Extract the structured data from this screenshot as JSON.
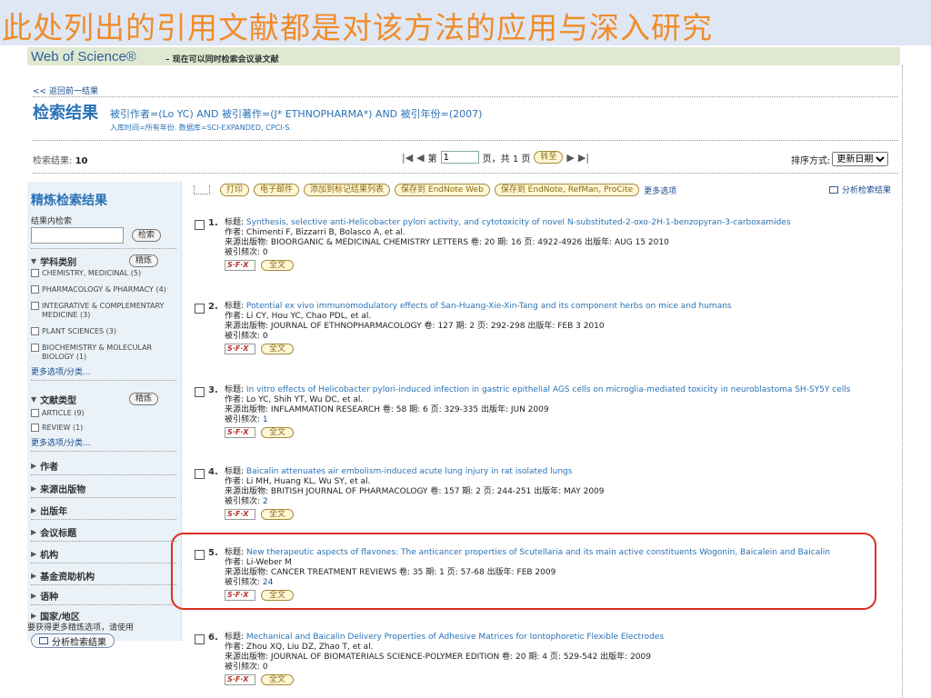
{
  "banner": {
    "text": "此处列出的引用文献都是对该方法的应用与深入研究"
  },
  "header": {
    "logo": "Web of Science®",
    "subtitle": "– 现在可以同时检索会议录文献"
  },
  "back_link": "<< 返回前一结果",
  "result": {
    "title": "检索结果",
    "query": "被引作者=(Lo YC) AND 被引著作=(J* ETHNOPHARMA*) AND 被引年份=(2007)",
    "meta": "入库时间=所有年份. 数据库=SCI-EXPANDED, CPCI-S."
  },
  "count": {
    "label": "检索结果:",
    "value": "10"
  },
  "pager": {
    "prefix": "第",
    "page": "1",
    "suffix": "页，共 1 页",
    "go": "转至",
    "first": "|◀",
    "prev": "◀",
    "next": "▶",
    "last": "▶|"
  },
  "sort": {
    "label": "排序方式:",
    "value": "更新日期"
  },
  "sidebar": {
    "title": "精炼检索结果",
    "within_label": "结果内检索",
    "search_btn": "检索",
    "refine_btn": "精炼",
    "sections": [
      {
        "title": "学科类别",
        "items": [
          "CHEMISTRY, MEDICINAL (5)",
          "PHARMACOLOGY & PHARMACY (4)",
          "INTEGRATIVE & COMPLEMENTARY MEDICINE (3)",
          "PLANT SCIENCES (3)",
          "BIOCHEMISTRY & MOLECULAR BIOLOGY (1)"
        ],
        "more": "更多选项/分类..."
      },
      {
        "title": "文献类型",
        "items": [
          "ARTICLE (9)",
          "REVIEW (1)"
        ],
        "more": "更多选项/分类..."
      }
    ],
    "collapsed": [
      "作者",
      "来源出版物",
      "出版年",
      "会议标题",
      "机构",
      "基金资助机构",
      "语种",
      "国家/地区"
    ],
    "note": "要获得更多精炼选项，请使用",
    "analyze_btn": "分析检索结果"
  },
  "toolbar": {
    "print": "打印",
    "email": "电子邮件",
    "add_marked": "添加到标记结果列表",
    "save_endnote_web": "保存到 EndNote Web",
    "save_endnote_refman": "保存到 EndNote, RefMan, ProCite",
    "more": "更多选项",
    "analyze": "分析检索结果"
  },
  "record_labels": {
    "title": "标题:",
    "authors": "作者:",
    "source": "来源出版物:",
    "cited": "被引频次:",
    "sfx": "S·F·X",
    "fulltext": "全文"
  },
  "records": [
    {
      "num": "1.",
      "title": "Synthesis, selective anti-Helicobacter pylori activity, and cytotoxicity of novel N-substituted-2-oxo-2H-1-benzopyran-3-carboxamides",
      "authors": "Chimenti F, Bizzarri B, Bolasco A, et al.",
      "source": "BIOORGANIC & MEDICINAL CHEMISTRY LETTERS  卷: 20  期: 16  页: 4922-4926  出版年: AUG 15 2010",
      "cited": "0"
    },
    {
      "num": "2.",
      "title": "Potential ex vivo immunomodulatory effects of San-Huang-Xie-Xin-Tang and its component herbs on mice and humans",
      "authors": "Li CY, Hou YC, Chao PDL, et al.",
      "source": "JOURNAL OF ETHNOPHARMACOLOGY  卷: 127  期: 2  页: 292-298  出版年: FEB 3 2010",
      "cited": "0"
    },
    {
      "num": "3.",
      "title": "In vitro effects of Helicobacter pylori-induced infection in gastric epithelial AGS cells on microglia-mediated toxicity in neuroblastoma SH-SY5Y cells",
      "authors": "Lo YC, Shih YT, Wu DC, et al.",
      "source": "INFLAMMATION RESEARCH  卷: 58  期: 6  页: 329-335  出版年: JUN 2009",
      "cited": "1"
    },
    {
      "num": "4.",
      "title": "Baicalin attenuates air embolism-induced acute lung injury in rat isolated lungs",
      "authors": "Li MH, Huang KL, Wu SY, et al.",
      "source": "BRITISH JOURNAL OF PHARMACOLOGY  卷: 157  期: 2  页: 244-251  出版年: MAY 2009",
      "cited": "2"
    },
    {
      "num": "5.",
      "title": "New therapeutic aspects of flavones: The anticancer properties of Scutellaria and its main active constituents Wogonin, Baicalein and Baicalin",
      "authors": "Li-Weber M",
      "source": "CANCER TREATMENT REVIEWS  卷: 35  期: 1  页: 57-68  出版年: FEB 2009",
      "cited": "24"
    },
    {
      "num": "6.",
      "title": "Mechanical and Baicalin Delivery Properties of Adhesive Matrices for Iontophoretic Flexible Electrodes",
      "authors": "Zhou XQ, Liu DZ, Zhao T, et al.",
      "source": "JOURNAL OF BIOMATERIALS SCIENCE-POLYMER EDITION  卷: 20  期: 4  页: 529-542  出版年: 2009",
      "cited": "0"
    }
  ]
}
